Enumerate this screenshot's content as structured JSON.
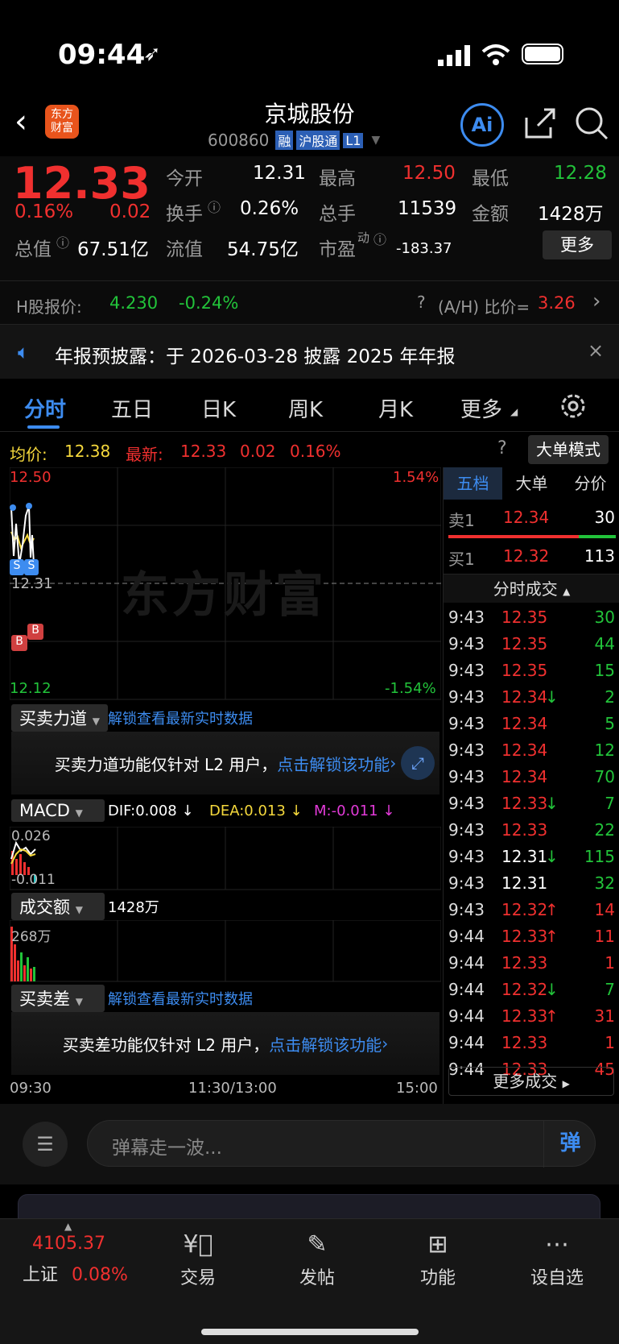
{
  "status_bar": {
    "time": "09:44"
  },
  "header": {
    "title": "京城股份",
    "code": "600860",
    "badges": [
      "融",
      "沪股通",
      "L1"
    ],
    "logo_text_1": "东方",
    "logo_text_2": "财富",
    "ai_label": "Ai"
  },
  "quote": {
    "price": "12.33",
    "change_pct": "0.16%",
    "change": "0.02",
    "open_label": "今开",
    "open": "12.31",
    "high_label": "最高",
    "high": "12.50",
    "low_label": "最低",
    "low": "12.28",
    "turnover_label": "换手",
    "turnover": "0.26%",
    "volume_label": "总手",
    "volume": "11539",
    "amount_label": "金额",
    "amount": "1428万",
    "mktcap_label": "总值",
    "mktcap": "67.51亿",
    "float_label": "流值",
    "float": "54.75亿",
    "pe_label": "市盈",
    "pe_sup": "动",
    "pe": "-183.37",
    "more_button": "更多"
  },
  "hshare": {
    "label": "H股报价:",
    "price": "4.230",
    "change": "-0.24%",
    "ah_label": "(A/H) 比价=",
    "ah_value": "3.26"
  },
  "notice": {
    "text": "年报预披露：于 2026-03-28 披露 2025 年年报"
  },
  "tabs": [
    "分时",
    "五日",
    "日K",
    "周K",
    "月K",
    "更多"
  ],
  "chart_info": {
    "avg_label": "均价:",
    "avg": "12.38",
    "latest_label": "最新:",
    "latest": "12.33",
    "latest_change": "0.02",
    "latest_pct": "0.16%",
    "big_order_button": "大单模式"
  },
  "price_axis": {
    "top": "12.50",
    "mid": "12.31",
    "bottom": "12.12",
    "top_pct": "1.54%",
    "bottom_pct": "-1.54%"
  },
  "watermark": "东方财富",
  "markers": {
    "s": "S",
    "b": "B"
  },
  "force_panel": {
    "selector": "买卖力道",
    "unlock": "解锁查看最新实时数据",
    "note": "买卖力道功能仅针对 L2 用户，",
    "note_link": "点击解锁该功能"
  },
  "macd_panel": {
    "selector": "MACD",
    "dif": "DIF:0.008 ↓",
    "dea": "DEA:0.013 ↓",
    "m": "M:-0.011 ↓",
    "top": "0.026",
    "bottom": "-0.011"
  },
  "amount_panel": {
    "selector": "成交额",
    "value": "1428万",
    "max": "268万"
  },
  "diff_panel": {
    "selector": "买卖差",
    "unlock": "解锁查看最新实时数据",
    "note": "买卖差功能仅针对 L2 用户，",
    "note_link": "点击解锁该功能"
  },
  "time_axis": [
    "09:30",
    "11:30/13:00",
    "15:00"
  ],
  "side_tabs": [
    "五档",
    "大单",
    "分价"
  ],
  "order_book": {
    "ask_label": "卖1",
    "ask_price": "12.34",
    "ask_vol": "30",
    "bid_label": "买1",
    "bid_price": "12.32",
    "bid_vol": "113"
  },
  "ticks_title": "分时成交",
  "ticks": [
    {
      "t": "9:43",
      "p": "12.35",
      "v": "30",
      "pc": "red",
      "vc": "green",
      "arrow": ""
    },
    {
      "t": "9:43",
      "p": "12.35",
      "v": "44",
      "pc": "red",
      "vc": "green",
      "arrow": ""
    },
    {
      "t": "9:43",
      "p": "12.35",
      "v": "15",
      "pc": "red",
      "vc": "green",
      "arrow": ""
    },
    {
      "t": "9:43",
      "p": "12.34",
      "v": "2",
      "pc": "red",
      "vc": "green",
      "arrow": "↓"
    },
    {
      "t": "9:43",
      "p": "12.34",
      "v": "5",
      "pc": "red",
      "vc": "green",
      "arrow": ""
    },
    {
      "t": "9:43",
      "p": "12.34",
      "v": "12",
      "pc": "red",
      "vc": "green",
      "arrow": ""
    },
    {
      "t": "9:43",
      "p": "12.34",
      "v": "70",
      "pc": "red",
      "vc": "green",
      "arrow": ""
    },
    {
      "t": "9:43",
      "p": "12.33",
      "v": "7",
      "pc": "red",
      "vc": "green",
      "arrow": "↓"
    },
    {
      "t": "9:43",
      "p": "12.33",
      "v": "22",
      "pc": "red",
      "vc": "green",
      "arrow": ""
    },
    {
      "t": "9:43",
      "p": "12.31",
      "v": "115",
      "pc": "white",
      "vc": "green",
      "arrow": "↓"
    },
    {
      "t": "9:43",
      "p": "12.31",
      "v": "32",
      "pc": "white",
      "vc": "green",
      "arrow": ""
    },
    {
      "t": "9:43",
      "p": "12.32",
      "v": "14",
      "pc": "red",
      "vc": "red",
      "arrow": "↑"
    },
    {
      "t": "9:44",
      "p": "12.33",
      "v": "11",
      "pc": "red",
      "vc": "red",
      "arrow": "↑"
    },
    {
      "t": "9:44",
      "p": "12.33",
      "v": "1",
      "pc": "red",
      "vc": "red",
      "arrow": ""
    },
    {
      "t": "9:44",
      "p": "12.32",
      "v": "7",
      "pc": "red",
      "vc": "green",
      "arrow": "↓"
    },
    {
      "t": "9:44",
      "p": "12.33",
      "v": "31",
      "pc": "red",
      "vc": "red",
      "arrow": "↑"
    },
    {
      "t": "9:44",
      "p": "12.33",
      "v": "1",
      "pc": "red",
      "vc": "red",
      "arrow": ""
    },
    {
      "t": "9:44",
      "p": "12.33",
      "v": "45",
      "pc": "red",
      "vc": "red",
      "arrow": ""
    }
  ],
  "more_ticks": "更多成交",
  "comment_input": {
    "placeholder": "弹幕走一波...",
    "button": "弹"
  },
  "bottom_nav": {
    "index_value": "4105.37",
    "index_name": "上证",
    "index_pct": "0.08%",
    "items": [
      "交易",
      "发帖",
      "功能",
      "设自选"
    ]
  },
  "colors": {
    "up": "#f0302f",
    "down": "#22c33a",
    "accent": "#3d8cf0",
    "avg": "#f5d83c"
  }
}
